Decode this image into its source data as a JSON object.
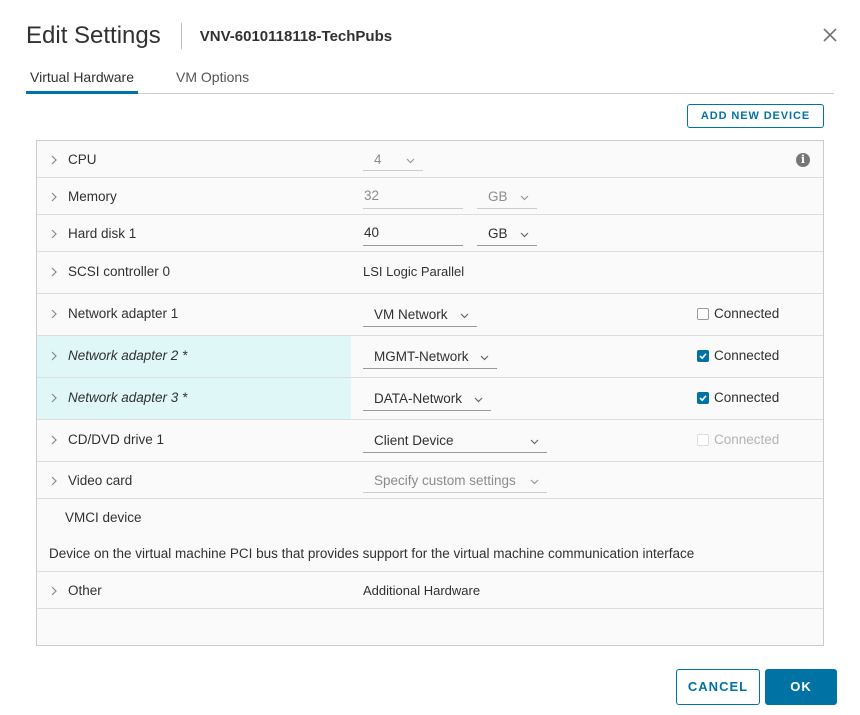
{
  "dialog": {
    "title": "Edit Settings",
    "vm_name": "VNV-6010118118-TechPubs"
  },
  "tabs": [
    {
      "label": "Virtual Hardware",
      "active": true
    },
    {
      "label": "VM Options",
      "active": false
    }
  ],
  "toolbar": {
    "add_device_label": "ADD NEW DEVICE"
  },
  "hardware": {
    "cpu": {
      "label": "CPU",
      "value": "4"
    },
    "memory": {
      "label": "Memory",
      "value": "32",
      "unit": "GB"
    },
    "hard_disk": {
      "label": "Hard disk 1",
      "value": "40",
      "unit": "GB"
    },
    "scsi": {
      "label": "SCSI controller 0",
      "value": "LSI Logic Parallel"
    },
    "net1": {
      "label": "Network adapter 1",
      "network": "VM Network",
      "connected_label": "Connected",
      "connected": false
    },
    "net2": {
      "label": "Network adapter 2 *",
      "network": "MGMT-Network",
      "connected_label": "Connected",
      "connected": true
    },
    "net3": {
      "label": "Network adapter 3 *",
      "network": "DATA-Network",
      "connected_label": "Connected",
      "connected": true
    },
    "cdrom": {
      "label": "CD/DVD drive 1",
      "value": "Client Device",
      "connected_label": "Connected",
      "connected": false
    },
    "video": {
      "label": "Video card",
      "value": "Specify custom settings"
    },
    "vmci": {
      "label": "VMCI device",
      "description": "Device on the virtual machine PCI bus that provides support for the virtual machine communication interface"
    },
    "other": {
      "label": "Other",
      "value": "Additional Hardware"
    }
  },
  "footer": {
    "cancel_label": "CANCEL",
    "ok_label": "OK"
  },
  "colors": {
    "accent": "#0072a3",
    "highlight": "#dff7f7"
  }
}
